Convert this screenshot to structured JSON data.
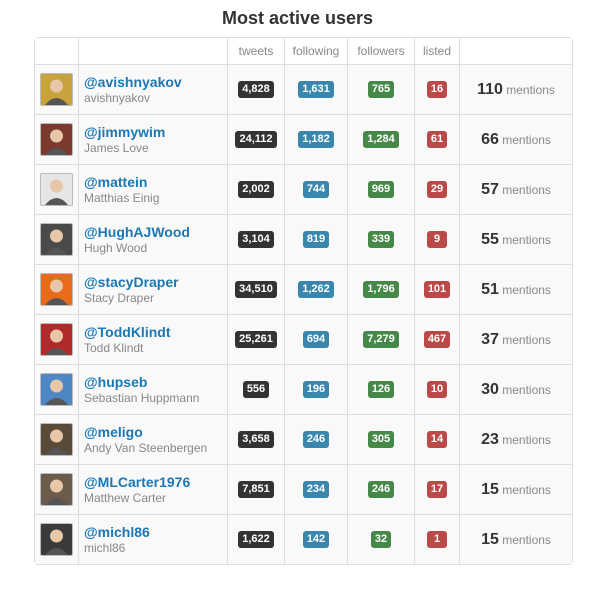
{
  "title": "Most active users",
  "columns": {
    "tweets": "tweets",
    "following": "following",
    "followers": "followers",
    "listed": "listed"
  },
  "mentions_label": "mentions",
  "colors": {
    "tweets": "#333333",
    "following": "#3a87ad",
    "followers": "#468847",
    "listed": "#b94a48",
    "link": "#1b78b4"
  },
  "users": [
    {
      "handle": "@avishnyakov",
      "name": "avishnyakov",
      "tweets": "4,828",
      "following": "1,631",
      "followers": "765",
      "listed": "16",
      "mentions": "110",
      "avatar_color": "#c8a23a"
    },
    {
      "handle": "@jimmywim",
      "name": "James Love",
      "tweets": "24,112",
      "following": "1,182",
      "followers": "1,284",
      "listed": "61",
      "mentions": "66",
      "avatar_color": "#7a3b2e"
    },
    {
      "handle": "@mattein",
      "name": "Matthias Einig",
      "tweets": "2,002",
      "following": "744",
      "followers": "969",
      "listed": "29",
      "mentions": "57",
      "avatar_color": "#e6e6e6"
    },
    {
      "handle": "@HughAJWood",
      "name": "Hugh Wood",
      "tweets": "3,104",
      "following": "819",
      "followers": "339",
      "listed": "9",
      "mentions": "55",
      "avatar_color": "#4a4a4a"
    },
    {
      "handle": "@stacyDraper",
      "name": "Stacy Draper",
      "tweets": "34,510",
      "following": "1,262",
      "followers": "1,796",
      "listed": "101",
      "mentions": "51",
      "avatar_color": "#e86a1a"
    },
    {
      "handle": "@ToddKlindt",
      "name": "Todd Klindt",
      "tweets": "25,261",
      "following": "694",
      "followers": "7,279",
      "listed": "467",
      "mentions": "37",
      "avatar_color": "#b02a2a"
    },
    {
      "handle": "@hupseb",
      "name": "Sebastian Huppmann",
      "tweets": "556",
      "following": "196",
      "followers": "126",
      "listed": "10",
      "mentions": "30",
      "avatar_color": "#4f86c6"
    },
    {
      "handle": "@meligo",
      "name": "Andy Van Steenbergen",
      "tweets": "3,658",
      "following": "246",
      "followers": "305",
      "listed": "14",
      "mentions": "23",
      "avatar_color": "#5a4a3a"
    },
    {
      "handle": "@MLCarter1976",
      "name": "Matthew Carter",
      "tweets": "7,851",
      "following": "234",
      "followers": "246",
      "listed": "17",
      "mentions": "15",
      "avatar_color": "#6b5b4b"
    },
    {
      "handle": "@michl86",
      "name": "michl86",
      "tweets": "1,622",
      "following": "142",
      "followers": "32",
      "listed": "1",
      "mentions": "15",
      "avatar_color": "#3a3a3a"
    }
  ]
}
